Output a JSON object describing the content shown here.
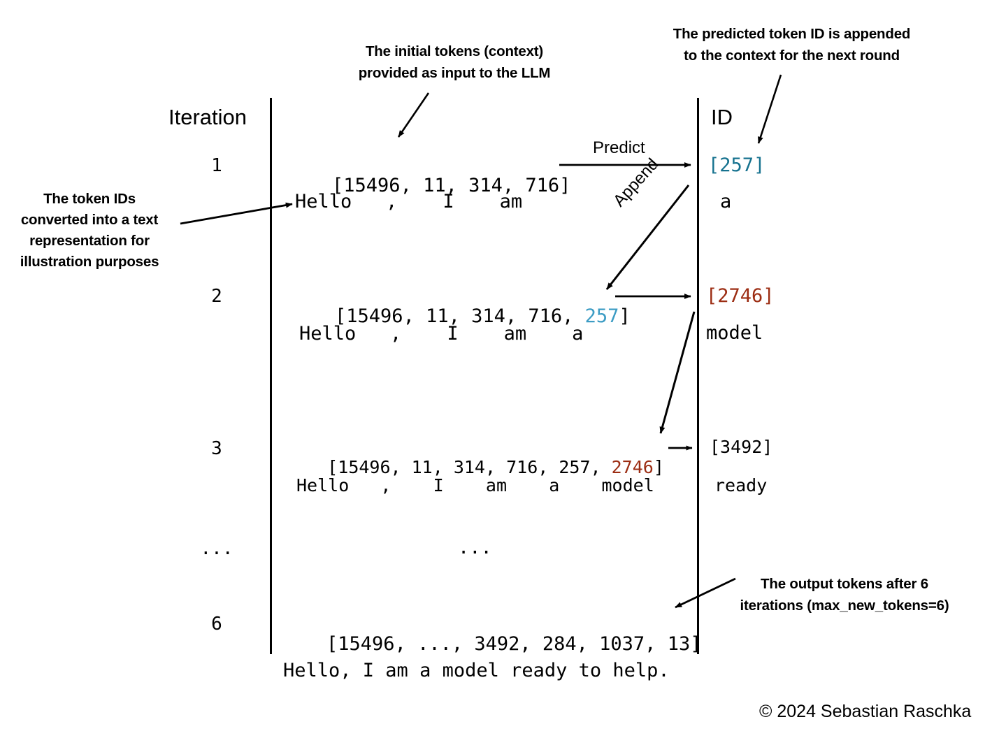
{
  "figure": {
    "title_columns": {
      "iteration_header": "Iteration",
      "id_header": "ID"
    },
    "copyright": "© 2024 Sebastian Raschka"
  },
  "annotations": [
    {
      "name": "initial-tokens-note",
      "text": "The initial tokens (context)\nprovided as input to the LLM"
    },
    {
      "name": "predicted-token-appended-note",
      "text": "The predicted token ID is appended\nto the context for the next round"
    },
    {
      "name": "token-ids-text-note",
      "text": "The token IDs\nconverted into a text\nrepresentation for\nillustration purposes"
    },
    {
      "name": "output-tokens-note",
      "text": "The output tokens after 6\niterations (max_new_tokens=6)"
    }
  ],
  "arrow_labels": {
    "predict": "Predict",
    "append": "Append"
  },
  "rows": [
    {
      "iteration": "1",
      "context_segments": [
        {
          "text": "[15496, 11, 314, 716]",
          "color": "black"
        }
      ],
      "context_text": "[15496, 11, 314, 716]",
      "decoded_text": "Hello   ,    I    am",
      "id_segments": [
        {
          "text": "[257]",
          "color": "blue"
        }
      ],
      "id_text": "[257]",
      "id_decoded": "a"
    },
    {
      "iteration": "2",
      "context_segments": [
        {
          "text": "[15496, 11, 314, 716, ",
          "color": "black"
        },
        {
          "text": "257",
          "color": "blue-light"
        },
        {
          "text": "]",
          "color": "black"
        }
      ],
      "context_text": "[15496, 11, 314, 716, 257]",
      "decoded_text": "Hello   ,    I    am    a",
      "id_segments": [
        {
          "text": "[2746]",
          "color": "red"
        }
      ],
      "id_text": "[2746]",
      "id_decoded": "model"
    },
    {
      "iteration": "3",
      "context_segments": [
        {
          "text": "[15496, 11, 314, 716, 257, ",
          "color": "black"
        },
        {
          "text": "2746",
          "color": "red"
        },
        {
          "text": "]",
          "color": "black"
        }
      ],
      "context_text": "[15496, 11, 314, 716, 257, 2746]",
      "decoded_text": "Hello   ,    I    am    a    model",
      "id_segments": [
        {
          "text": "[3492]",
          "color": "black"
        }
      ],
      "id_text": "[3492]",
      "id_decoded": "ready"
    },
    {
      "iteration": "...",
      "context_segments": [
        {
          "text": "...",
          "color": "black"
        }
      ],
      "context_text": "...",
      "decoded_text": "",
      "id_segments": [],
      "id_text": "",
      "id_decoded": ""
    },
    {
      "iteration": "6",
      "context_segments": [
        {
          "text": "[15496, ..., 3492, 284, 1037, 13]",
          "color": "black"
        }
      ],
      "context_text": "[15496, ..., 3492, 284, 1037, 13]",
      "decoded_text": "",
      "id_segments": [],
      "id_text": "",
      "id_decoded": ""
    }
  ],
  "final_output_text": "Hello, I am a model ready to help.",
  "colors": {
    "blue": "#16728F",
    "blue_light": "#3C9CC4",
    "red": "#9C2D13",
    "ink": "#000000",
    "background": "#FFFFFF"
  }
}
